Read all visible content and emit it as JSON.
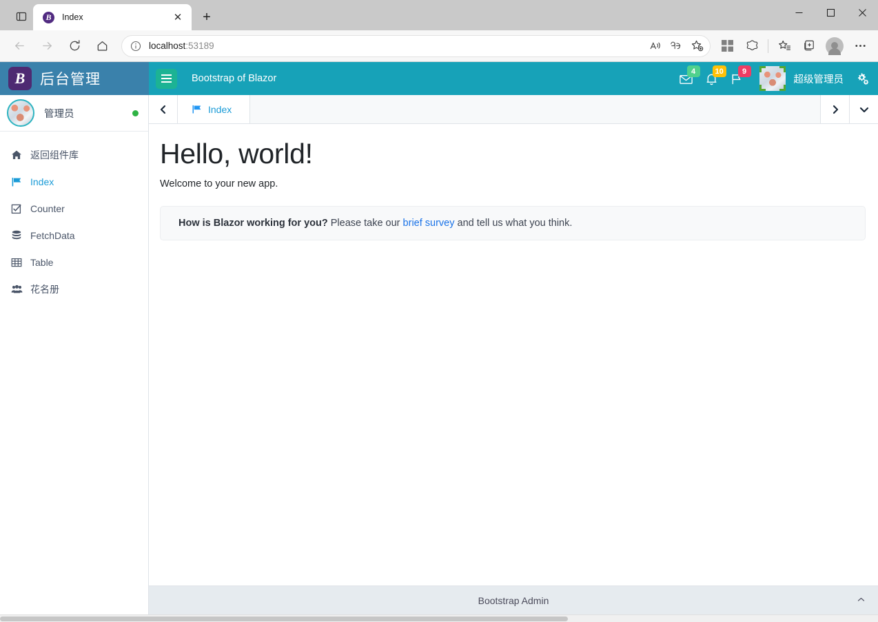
{
  "browser": {
    "tab": {
      "title": "Index",
      "favicon_letter": "B",
      "close_label": "✕"
    },
    "new_tab_label": "+",
    "window_controls": {
      "minimize": "minimize-icon",
      "maximize": "maximize-icon",
      "close": "close-icon"
    },
    "nav": {
      "back": "back-icon",
      "forward": "forward-icon",
      "reload": "reload-icon",
      "home": "home-icon"
    },
    "address": {
      "host": "localhost",
      "port": ":53189",
      "security_icon": "info-icon"
    },
    "omnibox_actions": [
      "read-aloud-icon",
      "translate-icon",
      "add-favorite-icon"
    ],
    "toolbar_icons": [
      "collections-grid-icon",
      "browser-essentials-icon",
      "favorites-icon",
      "split-screen-icon",
      "profile-icon",
      "settings-more-icon"
    ]
  },
  "app": {
    "logo_letter": "B",
    "logo_text": "后台管理",
    "title": "Bootstrap of Blazor",
    "menu_toggle": "hamburger-icon",
    "notifications": [
      {
        "icon": "mail-icon",
        "count": "4",
        "color": "#50d18d",
        "tone": "green"
      },
      {
        "icon": "bell-icon",
        "count": "10",
        "color": "#ffc107",
        "tone": "yellow"
      },
      {
        "icon": "flag-icon",
        "count": "9",
        "color": "#ef3d64",
        "tone": "pink"
      }
    ],
    "user_name": "超级管理员",
    "settings_icon": "cogs-icon"
  },
  "sidebar": {
    "user": {
      "name": "管理员",
      "status": "online",
      "status_color": "#2fb344"
    },
    "items": [
      {
        "label": "返回组件库",
        "icon": "home-icon",
        "active": false
      },
      {
        "label": "Index",
        "icon": "flag-icon",
        "active": true
      },
      {
        "label": "Counter",
        "icon": "check-square-icon",
        "active": false
      },
      {
        "label": "FetchData",
        "icon": "database-icon",
        "active": false
      },
      {
        "label": "Table",
        "icon": "table-icon",
        "active": false
      },
      {
        "label": "花名册",
        "icon": "users-icon",
        "active": false
      }
    ]
  },
  "tabbar": {
    "scroll_left": "chevron-left-icon",
    "scroll_right": "chevron-right-icon",
    "dropdown": "chevron-down-icon",
    "tabs": [
      {
        "label": "Index",
        "icon": "flag-icon",
        "active": true
      }
    ]
  },
  "main": {
    "heading": "Hello, world!",
    "subtitle": "Welcome to your new app.",
    "survey": {
      "strong": "How is Blazor working for you?",
      "before_link": " Please take our ",
      "link": "brief survey",
      "after_link": " and tell us what you think."
    }
  },
  "footer": {
    "text": "Bootstrap Admin",
    "collapse_icon": "chevron-up-icon"
  }
}
